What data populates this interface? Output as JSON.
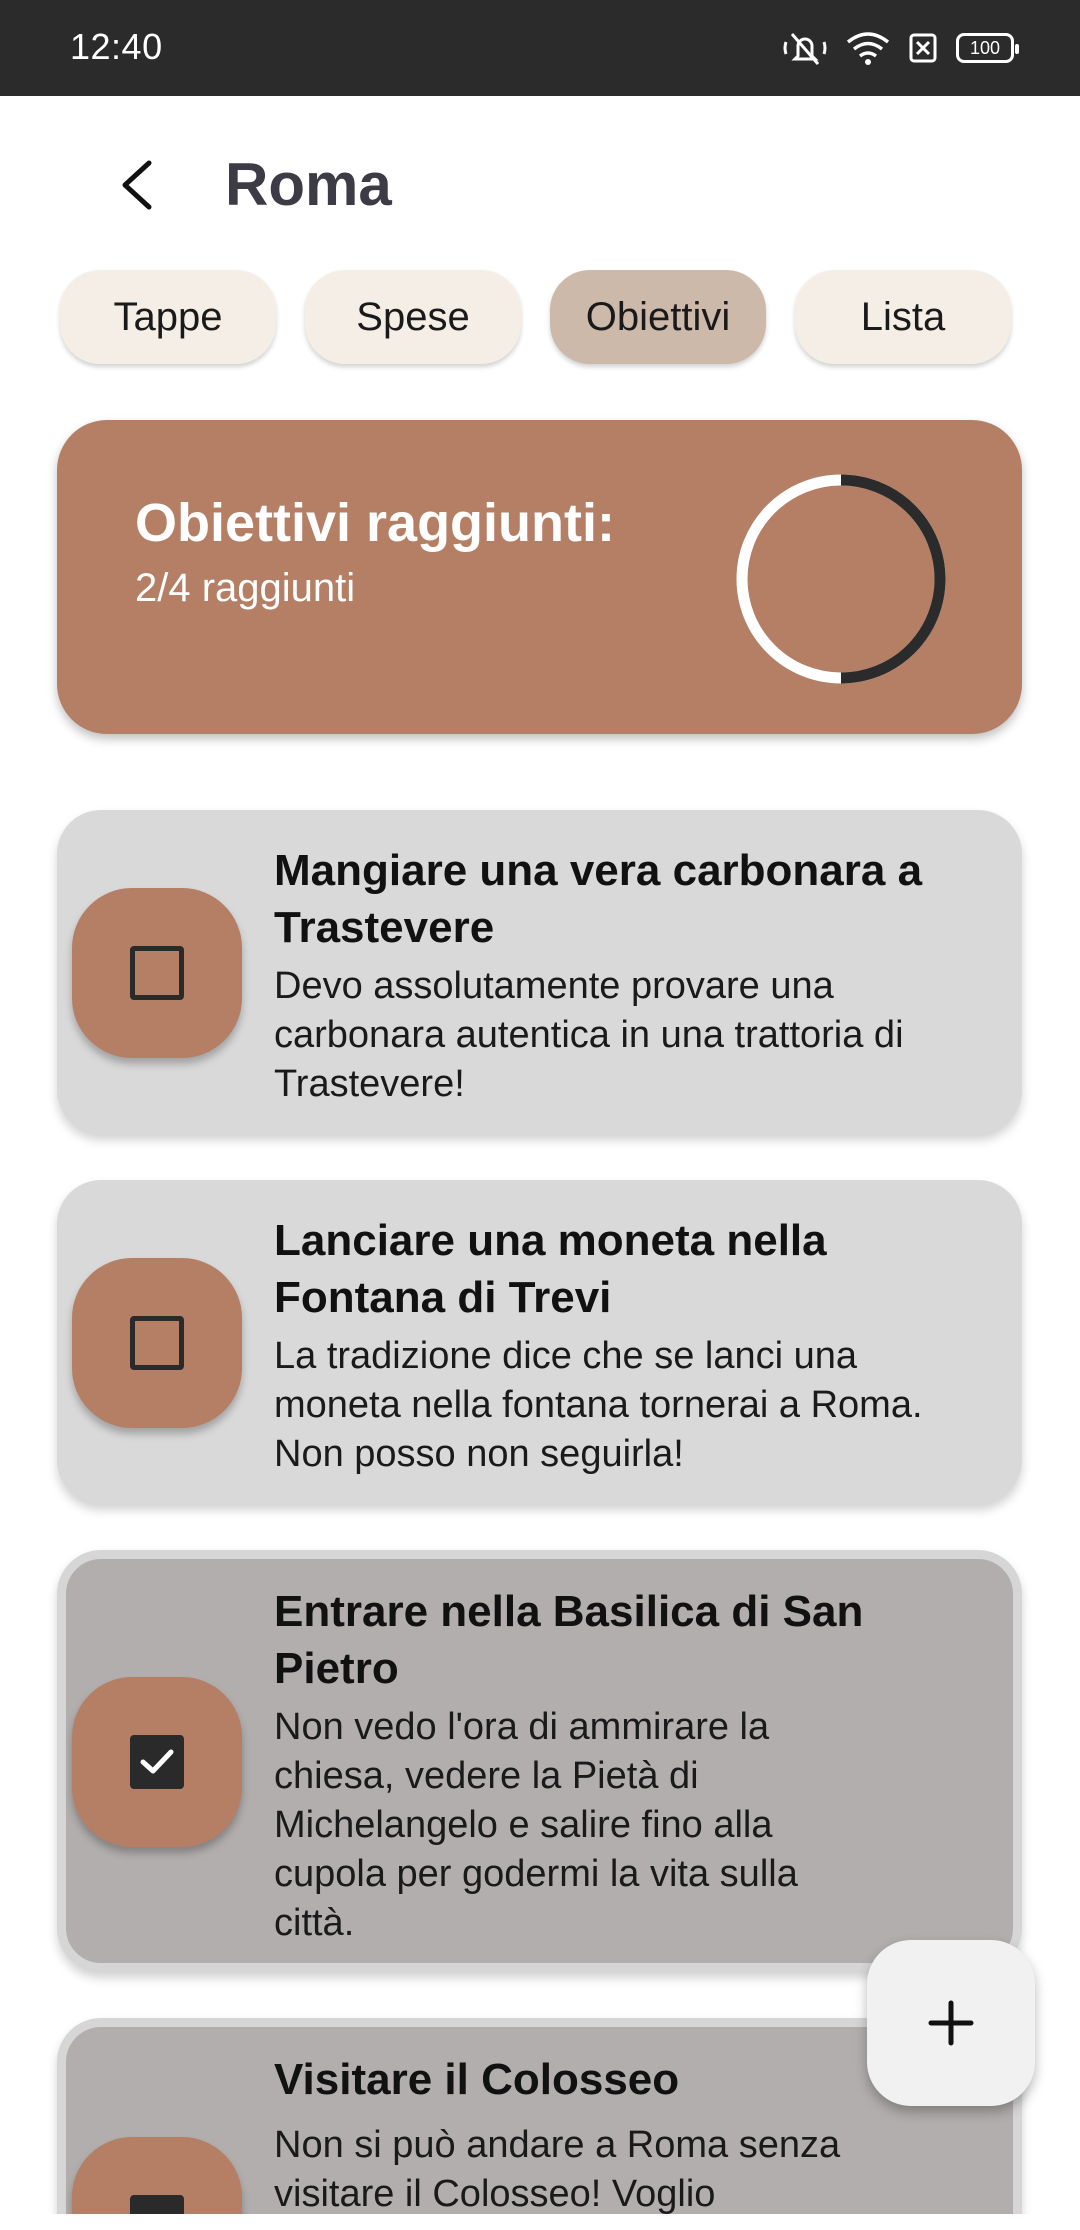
{
  "status_bar": {
    "time": "12:40",
    "battery": "100"
  },
  "header": {
    "title": "Roma",
    "back_icon": "chevron-left-icon"
  },
  "tabs": [
    {
      "label": "Tappe",
      "active": false
    },
    {
      "label": "Spese",
      "active": false
    },
    {
      "label": "Obiettivi",
      "active": true
    },
    {
      "label": "Lista",
      "active": false
    }
  ],
  "summary": {
    "title": "Obiettivi raggiunti:",
    "subtitle": "2/4 raggiunti",
    "progress_fraction": 0.5
  },
  "goals": [
    {
      "title": "Mangiare una vera carbonara a Trastevere",
      "description": "Devo assolutamente provare una carbonara autentica in una trattoria di Trastevere!",
      "completed": false
    },
    {
      "title": "Lanciare una moneta nella Fontana di Trevi",
      "description": "La tradizione dice che se lanci una moneta nella fontana tornerai a Roma. Non posso non seguirla!",
      "completed": false
    },
    {
      "title": "Entrare nella Basilica di San Pietro",
      "description": "Non vedo l'ora di ammirare la chiesa, vedere la Pietà di Michelangelo e salire fino alla cupola per godermi la vita sulla città.",
      "completed": true
    },
    {
      "title": "Visitare il Colosseo",
      "description": "Non si può andare a Roma senza visitare il Colosseo! Voglio",
      "completed": true
    }
  ],
  "fab": {
    "icon": "plus-icon"
  },
  "colors": {
    "accent": "#b47f65",
    "tab_bg": "#f5eee6",
    "tab_active_bg": "#cdb9aa",
    "card_bg": "#d9d9d9",
    "card_done_bg": "#b2aeae"
  }
}
